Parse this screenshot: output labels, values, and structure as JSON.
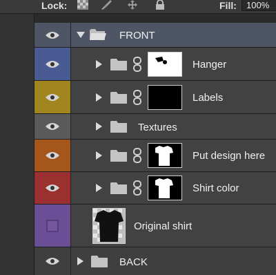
{
  "options_bar": {
    "lock_label": "Lock:",
    "fill_label": "Fill:",
    "fill_value": "100%",
    "lock_icons": [
      "lock-transparent-pixels-icon",
      "lock-image-pixels-icon",
      "lock-position-icon",
      "lock-all-icon"
    ]
  },
  "layers": [
    {
      "name": "FRONT",
      "kind": "group",
      "expanded": true,
      "visible": true,
      "color_tag": "#4e5564"
    },
    {
      "name": "Hanger",
      "kind": "group-with-mask",
      "expanded": false,
      "visible": true,
      "color_tag": "#4a5b94"
    },
    {
      "name": "Labels",
      "kind": "group-with-mask",
      "expanded": false,
      "visible": true,
      "color_tag": "#a1861f"
    },
    {
      "name": "Textures",
      "kind": "group",
      "expanded": false,
      "visible": true,
      "color_tag": "#5a5a5a"
    },
    {
      "name": "Put design here",
      "kind": "group-with-mask",
      "expanded": false,
      "visible": true,
      "color_tag": "#a5561a"
    },
    {
      "name": "Shirt color",
      "kind": "group-with-mask",
      "expanded": false,
      "visible": true,
      "color_tag": "#9a3030"
    },
    {
      "name": "Original shirt",
      "kind": "image-layer",
      "visible": false,
      "color_tag": "#6a4f96"
    },
    {
      "name": "BACK",
      "kind": "group",
      "expanded": false,
      "visible": true,
      "color_tag": "#3f3f3f"
    }
  ]
}
